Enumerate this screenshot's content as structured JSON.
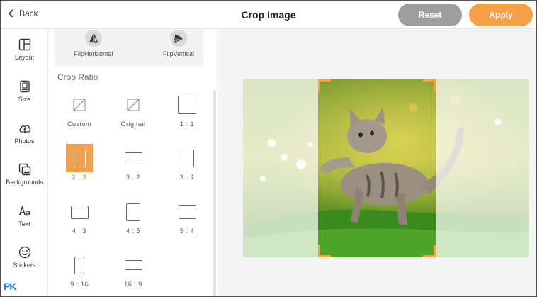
{
  "topbar": {
    "back_label": "Back",
    "title": "Crop Image",
    "reset_label": "Reset",
    "apply_label": "Apply"
  },
  "nav": {
    "items": [
      {
        "label": "Layout",
        "icon": "layout-icon"
      },
      {
        "label": "Size",
        "icon": "size-icon"
      },
      {
        "label": "Photos",
        "icon": "cloud-upload-icon"
      },
      {
        "label": "Backgrounds",
        "icon": "backgrounds-icon"
      },
      {
        "label": "Text",
        "icon": "text-icon"
      },
      {
        "label": "Stickers",
        "icon": "smiley-icon"
      }
    ],
    "watermark": "PK"
  },
  "panel": {
    "flip_horizontal_label": "FlipHorizontal",
    "flip_vertical_label": "FlipVertical",
    "section_title": "Crop Ratio",
    "ratios": [
      {
        "label": "Custom",
        "selected": false
      },
      {
        "label": "Original",
        "selected": false
      },
      {
        "label": "1 : 1",
        "selected": false
      },
      {
        "label": "2 : 3",
        "selected": true
      },
      {
        "label": "3 : 2",
        "selected": false
      },
      {
        "label": "3 : 4",
        "selected": false
      },
      {
        "label": "4 : 3",
        "selected": false
      },
      {
        "label": "4 : 5",
        "selected": false
      },
      {
        "label": "5 : 4",
        "selected": false
      },
      {
        "label": "9 : 16",
        "selected": false
      },
      {
        "label": "16 : 9",
        "selected": false
      }
    ]
  },
  "colors": {
    "accent": "#f5a046",
    "reset": "#9e9e9e",
    "canvas_bg": "#f4f4f4"
  }
}
